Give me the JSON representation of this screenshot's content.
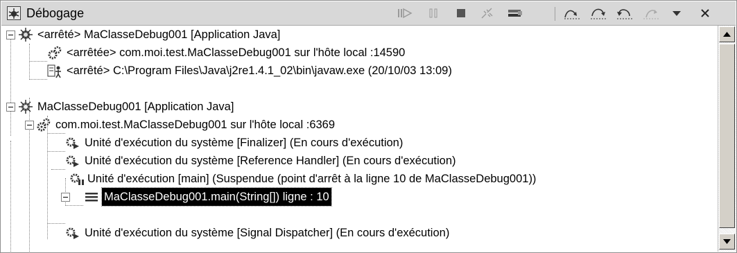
{
  "view": {
    "title": "Débogage",
    "icon": "debug-view-icon"
  },
  "toolbar": [
    {
      "name": "resume-button",
      "icon": "resume-icon",
      "glyph": "⧐",
      "enabled": false
    },
    {
      "name": "suspend-button",
      "icon": "suspend-icon",
      "glyph": "⏸",
      "enabled": false
    },
    {
      "name": "terminate-button",
      "icon": "terminate-icon",
      "glyph": "■",
      "enabled": true
    },
    {
      "name": "disconnect-button",
      "icon": "disconnect-icon",
      "glyph": "⚯",
      "enabled": false
    },
    {
      "name": "remove-terminated-button",
      "icon": "remove-terminated-icon",
      "glyph": "▤",
      "enabled": true
    },
    {
      "name": "step-into-button",
      "icon": "step-into-icon",
      "glyph": "⤵",
      "enabled": true
    },
    {
      "name": "step-over-button",
      "icon": "step-over-icon",
      "glyph": "↷",
      "enabled": true
    },
    {
      "name": "step-return-button",
      "icon": "step-return-icon",
      "glyph": "↶",
      "enabled": true
    },
    {
      "name": "drop-to-frame-button",
      "icon": "drop-to-frame-icon",
      "glyph": "⇢",
      "enabled": false
    },
    {
      "name": "view-menu-button",
      "icon": "chevron-down-icon",
      "glyph": "▾",
      "enabled": true
    },
    {
      "name": "close-view-button",
      "icon": "close-icon",
      "glyph": "×",
      "enabled": true
    }
  ],
  "tree": [
    {
      "text": "<arrêté> MaClasseDebug001 [Application Java]",
      "icon": "launch-terminated-icon"
    },
    {
      "text": "<arrêtée> com.moi.test.MaClasseDebug001 sur l'hôte local :14590",
      "icon": "debug-target-terminated-icon"
    },
    {
      "text": "<arrêté> C:\\Program Files\\Java\\j2re1.4.1_02\\bin\\javaw.exe (20/10/03 13:09)",
      "icon": "process-icon"
    },
    {
      "text": "MaClasseDebug001 [Application Java]",
      "icon": "launch-icon"
    },
    {
      "text": "com.moi.test.MaClasseDebug001 sur l'hôte local :6369",
      "icon": "debug-target-icon"
    },
    {
      "text": "Unité d'exécution du système [Finalizer] (En cours d'exécution)",
      "icon": "thread-running-icon"
    },
    {
      "text": "Unité d'exécution du système [Reference Handler] (En cours d'exécution)",
      "icon": "thread-running-icon"
    },
    {
      "text": "Unité d'exécution [main] (Suspendue (point d'arrêt à la ligne 10 de MaClasseDebug001))",
      "icon": "thread-suspended-icon"
    },
    {
      "text": "MaClasseDebug001.main(String[]) ligne : 10",
      "icon": "stack-frame-icon"
    },
    {
      "text": "Unité d'exécution du système [Signal Dispatcher] (En cours d'exécution)",
      "icon": "thread-running-icon"
    }
  ],
  "scrollbar": {
    "up_icon": "arrow-up-icon",
    "down_icon": "arrow-down-icon"
  }
}
